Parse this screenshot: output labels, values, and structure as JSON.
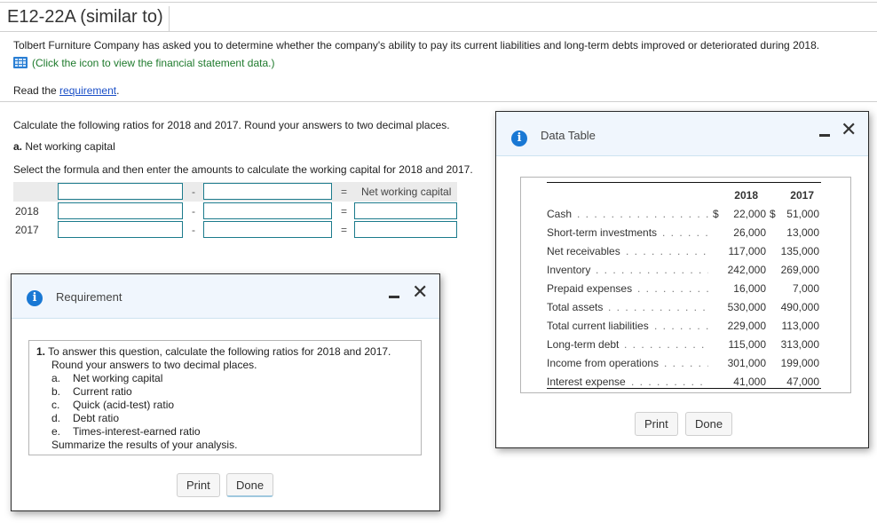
{
  "page": {
    "title": "E12-22A (similar to)",
    "intro": "Tolbert Furniture Company has asked you to determine whether the company's ability to pay its current liabilities and long-term debts improved or deteriorated during 2018.",
    "data_link": "(Click the icon to view the financial statement data.)",
    "read_prefix": "Read the ",
    "read_link": "requirement",
    "read_suffix": ".",
    "instructions": "Calculate the following ratios for 2018 and 2017. Round your answers to two decimal places.",
    "part_letter": "a.",
    "part_title": " Net working capital",
    "formula_prompt": "Select the formula and then enter the amounts to calculate the working capital for 2018 and 2017."
  },
  "formula": {
    "minus": "-",
    "equals": "=",
    "result_label": "Net working capital",
    "rows": [
      {
        "year": "2018",
        "a": "",
        "b": "",
        "result": ""
      },
      {
        "year": "2017",
        "a": "",
        "b": "",
        "result": ""
      }
    ],
    "header": {
      "a": "",
      "b": ""
    }
  },
  "requirement_dialog": {
    "title": "Requirement",
    "icon": "info-icon",
    "num": "1.",
    "line1": "To answer this question, calculate the following ratios for 2018 and 2017.",
    "line2": "Round your answers to two decimal places.",
    "items": [
      {
        "letter": "a.",
        "text": "Net working capital"
      },
      {
        "letter": "b.",
        "text": "Current ratio"
      },
      {
        "letter": "c.",
        "text": "Quick (acid-test) ratio"
      },
      {
        "letter": "d.",
        "text": "Debt ratio"
      },
      {
        "letter": "e.",
        "text": "Times-interest-earned ratio"
      }
    ],
    "summary": "Summarize the results of your analysis.",
    "print_label": "Print",
    "done_label": "Done"
  },
  "data_dialog": {
    "title": "Data Table",
    "icon": "info-icon",
    "col_2018": "2018",
    "col_2017": "2017",
    "currency": "$",
    "rows": [
      {
        "name": "Cash",
        "v2018": "22,000",
        "v2017": "51,000",
        "currency": true
      },
      {
        "name": "Short-term investments",
        "v2018": "26,000",
        "v2017": "13,000"
      },
      {
        "name": "Net receivables",
        "v2018": "117,000",
        "v2017": "135,000"
      },
      {
        "name": "Inventory",
        "v2018": "242,000",
        "v2017": "269,000"
      },
      {
        "name": "Prepaid expenses",
        "v2018": "16,000",
        "v2017": "7,000"
      },
      {
        "name": "Total assets",
        "v2018": "530,000",
        "v2017": "490,000"
      },
      {
        "name": "Total current liabilities",
        "v2018": "229,000",
        "v2017": "113,000"
      },
      {
        "name": "Long-term debt",
        "v2018": "115,000",
        "v2017": "313,000"
      },
      {
        "name": "Income from operations",
        "v2018": "301,000",
        "v2017": "199,000"
      },
      {
        "name": "Interest expense",
        "v2018": "41,000",
        "v2017": "47,000"
      }
    ],
    "print_label": "Print",
    "done_label": "Done"
  }
}
